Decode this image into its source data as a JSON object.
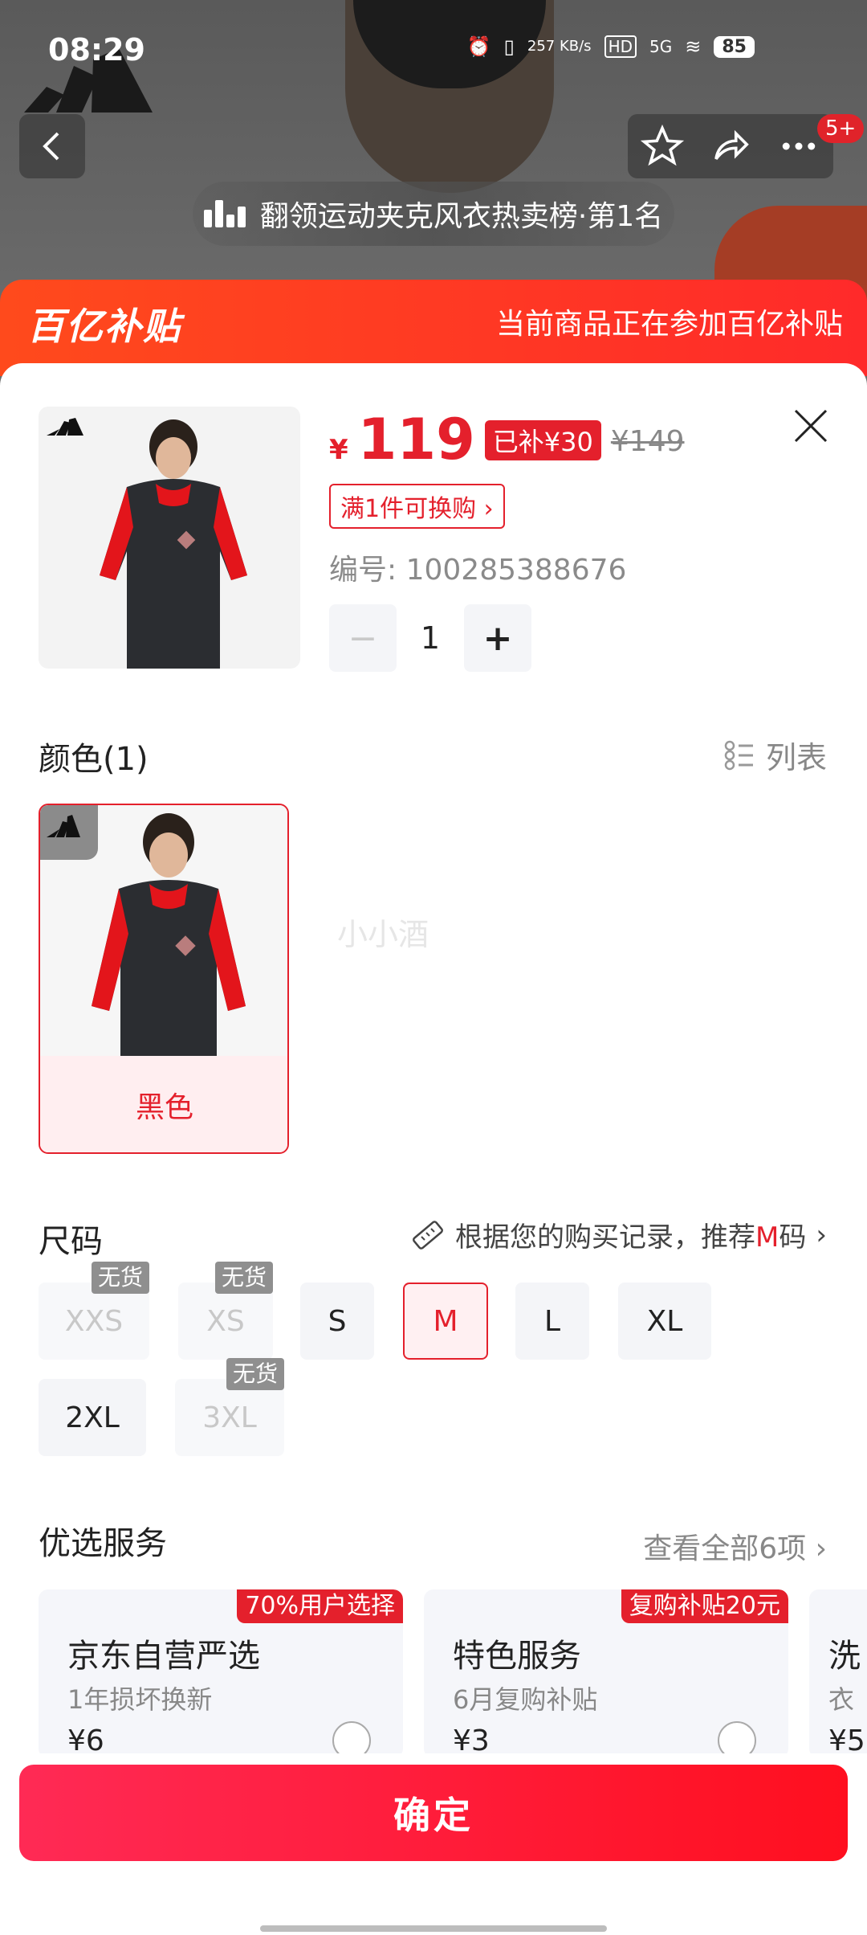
{
  "status": {
    "time": "08:29",
    "net_speed": "257 KB/s",
    "hd": "HD",
    "signal": "5G",
    "battery": "85"
  },
  "nav": {
    "notify_badge": "5+"
  },
  "rank": {
    "text": "翻领运动夹克风衣热卖榜·第1名"
  },
  "banner": {
    "logo": "百亿补贴",
    "text": "当前商品正在参加百亿补贴"
  },
  "product": {
    "yen": "¥",
    "price": "119",
    "subsidy": "已补¥30",
    "original": "¥149",
    "promo": "满1件可换购",
    "sku": "编号: 100285388676",
    "quantity": "1"
  },
  "color": {
    "title": "颜色(1)",
    "list_label": "列表",
    "option": "黑色",
    "watermark": "小小酒"
  },
  "size": {
    "title": "尺码",
    "recommend_prefix": "根据您的购买记录，推荐",
    "recommend_size": "M",
    "recommend_suffix": "码",
    "oos_label": "无货",
    "options": [
      "XXS",
      "XS",
      "S",
      "M",
      "L",
      "XL",
      "2XL",
      "3XL"
    ]
  },
  "services": {
    "title": "优选服务",
    "view_all": "查看全部6项",
    "cards": [
      {
        "tag": "70%用户选择",
        "name": "京东自营严选",
        "desc": "1年损坏换新",
        "price": "¥6"
      },
      {
        "tag": "复购补贴20元",
        "name": "特色服务",
        "desc": "6月复购补贴",
        "price": "¥3"
      },
      {
        "name": "洗",
        "desc": "衣",
        "price": "¥5"
      }
    ]
  },
  "confirm_label": "确定",
  "colors": {
    "accent": "#e4202c",
    "banner": "#ff3a1f"
  }
}
